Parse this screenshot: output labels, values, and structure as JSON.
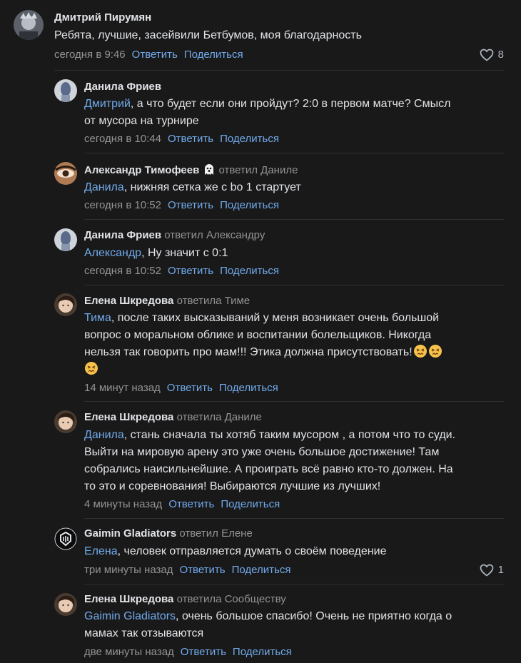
{
  "comments": [
    {
      "author": "Дмитрий Пирумян",
      "replied_to": "",
      "mention": "",
      "text": "Ребята, лучшие, засейвили Бетбумов, моя благодарность",
      "time": "сегодня в 9:46",
      "reply_label": "Ответить",
      "share_label": "Поделиться",
      "likes": "8"
    },
    {
      "author": "Данила Фриев",
      "replied_to": "",
      "mention": "Дмитрий",
      "text": ", а что будет если они пройдут? 2:0 в первом матче? Смысл\nот мусора на турнире",
      "time": "сегодня в 10:44",
      "reply_label": "Ответить",
      "share_label": "Поделиться"
    },
    {
      "author": "Александр Тимофеев",
      "replied_to": "ответил Даниле",
      "mention": "Данила",
      "text": ", нижняя сетка же с bo 1 стартует",
      "time": "сегодня в 10:52",
      "reply_label": "Ответить",
      "share_label": "Поделиться"
    },
    {
      "author": "Данила Фриев",
      "replied_to": "ответил Александру",
      "mention": "Александр",
      "text": ", Ну значит с 0:1",
      "time": "сегодня в 10:52",
      "reply_label": "Ответить",
      "share_label": "Поделиться"
    },
    {
      "author": "Елена Шкредова",
      "replied_to": "ответила Тиме",
      "mention": "Тима",
      "text": ", после таких высказываний у меня возникает очень большой\nвопрос о моральном облике и воспитании болельщиков. Никогда\nнельзя так говорить про мам!!! Этика должна присутствовать!",
      "time": "14 минут назад",
      "reply_label": "Ответить",
      "share_label": "Поделиться"
    },
    {
      "author": "Елена Шкредова",
      "replied_to": "ответила Даниле",
      "mention": "Данила",
      "text": ", стань сначала ты хотяб таким мусором , а потом что то суди.\nВыйти на мировую арену это уже очень большое достижение! Там\nсобрались наисильнейшие. А проиграть всё равно кто-то должен. На\nто это и соревнования! Выбираются лучшие из лучших!",
      "time": "4 минуты назад",
      "reply_label": "Ответить",
      "share_label": "Поделиться"
    },
    {
      "author": "Gaimin Gladiators",
      "replied_to": "ответил Елене",
      "mention": "Елена",
      "text": ", человек отправляется думать о своём поведение",
      "time": "три минуты назад",
      "reply_label": "Ответить",
      "share_label": "Поделиться",
      "likes": "1"
    },
    {
      "author": "Елена Шкредова",
      "replied_to": "ответила Сообществу",
      "mention": "Gaimin Gladiators",
      "text": ", очень большое спасибо! Очень не приятно когда о\nмамах так отзываются",
      "time": "две минуты назад",
      "reply_label": "Ответить",
      "share_label": "Поделиться"
    }
  ],
  "icons": {
    "like": "heart-outline-icon",
    "badge": "ghost-emoji-icon",
    "emoji": "persevering-face-emoji-icon"
  },
  "colors": {
    "background": "#19191a",
    "text": "#e1e3e6",
    "secondary": "#939393",
    "link": "#71aaeb"
  }
}
